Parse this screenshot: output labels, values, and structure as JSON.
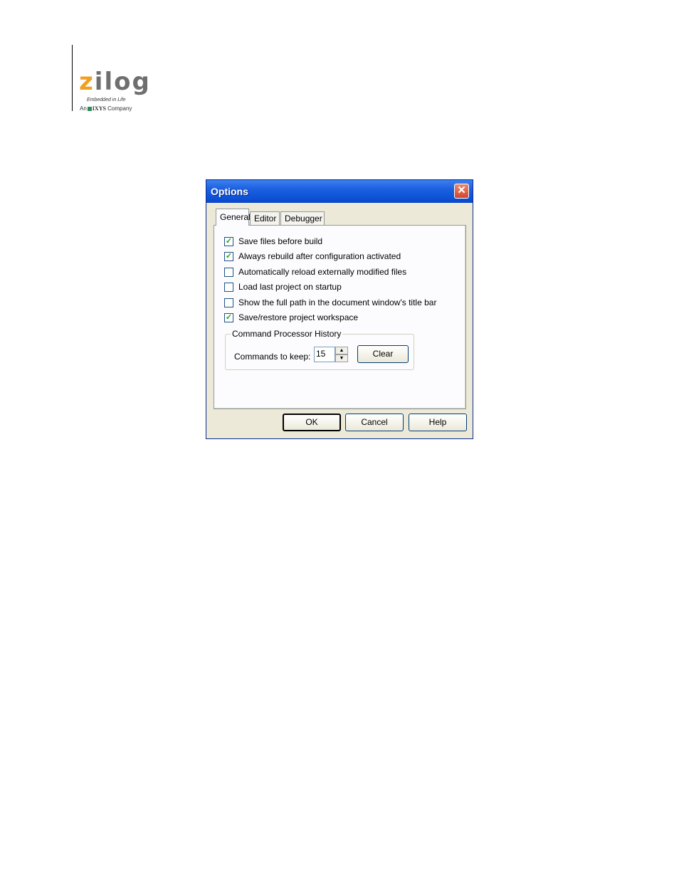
{
  "logo": {
    "word_first": "z",
    "word_rest": "ilog",
    "tagline": "Embedded in Life",
    "company_prefix": "An",
    "company_name": "IXYS",
    "company_suffix": "Company"
  },
  "dialog": {
    "title": "Options",
    "close_glyph": "✕",
    "tabs": [
      {
        "label": "General",
        "active": true
      },
      {
        "label": "Editor",
        "active": false
      },
      {
        "label": "Debugger",
        "active": false
      }
    ],
    "options": [
      {
        "label": "Save files before build",
        "checked": true
      },
      {
        "label": "Always rebuild after configuration activated",
        "checked": true
      },
      {
        "label": "Automatically reload externally modified files",
        "checked": false
      },
      {
        "label": "Load last project on startup",
        "checked": false
      },
      {
        "label": "Show the full path in the document window's title bar",
        "checked": false
      },
      {
        "label": "Save/restore project workspace",
        "checked": true
      }
    ],
    "history_group": {
      "title": "Command Processor History",
      "commands_label": "Commands to keep:",
      "commands_value": "15",
      "clear_label": "Clear"
    },
    "buttons": {
      "ok": "OK",
      "cancel": "Cancel",
      "help": "Help"
    }
  },
  "colors": {
    "titlebar": "#0b4fd6",
    "dialog_bg": "#ece9d8",
    "check_mark": "#21a121",
    "logo_accent": "#f0a020"
  },
  "icons": {
    "close": "close-icon",
    "check": "checkmark-icon",
    "spin_up": "arrow-up-icon",
    "spin_down": "arrow-down-icon"
  }
}
